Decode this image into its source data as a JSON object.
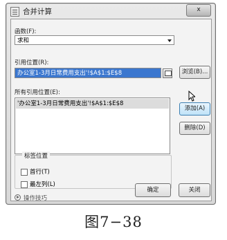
{
  "window": {
    "title": "合并计算",
    "close_label": "x"
  },
  "function": {
    "label": "函数(F):",
    "value": "求和"
  },
  "reference": {
    "label": "引用位置(R):",
    "value": "办公室1-3月日常费用支出'!$A$1:$E$8",
    "browse_label": "浏览(B)..."
  },
  "all_references": {
    "label": "所有引用位置(E):",
    "items": [
      "'办公室1-3月日常费用支出'!$A$1:$E$8"
    ],
    "add_label": "添加(A)",
    "delete_label": "删除(D)"
  },
  "label_position": {
    "legend": "标签位置",
    "top_row_label": "首行(T)",
    "left_column_label": "最左列(L)"
  },
  "footer": {
    "tips_label": "操作技巧",
    "ok_label": "确定",
    "close_label": "关闭"
  },
  "caption": "图7−38"
}
